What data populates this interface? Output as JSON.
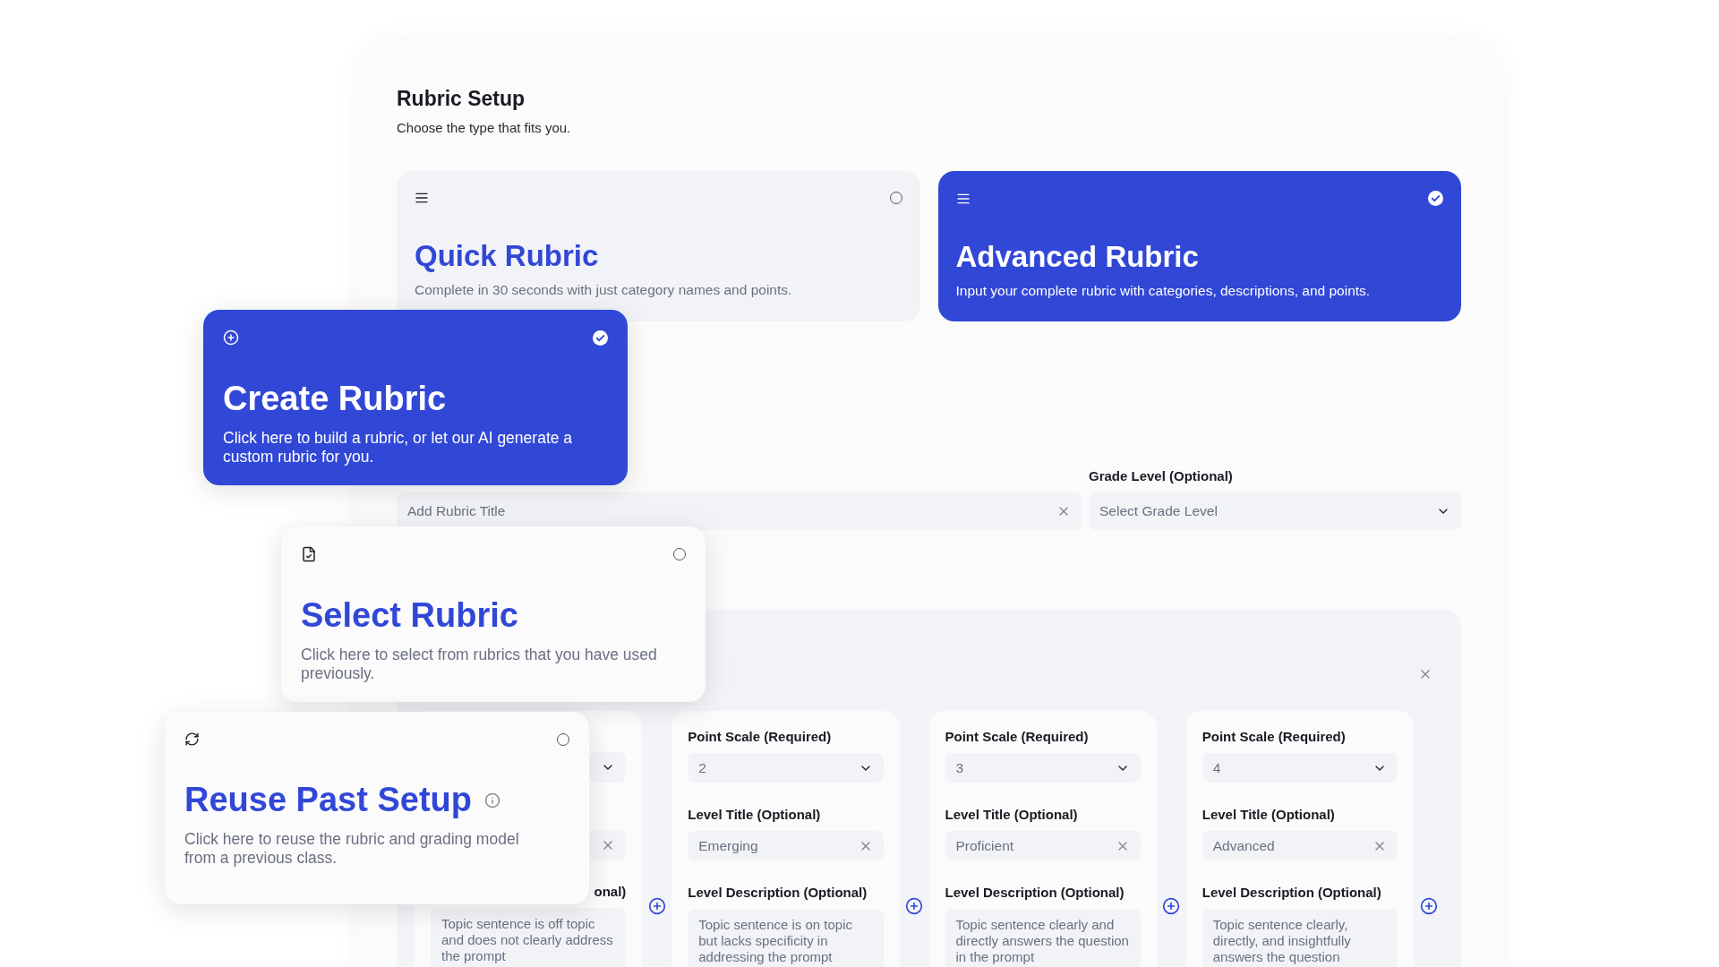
{
  "setup": {
    "title": "Rubric Setup",
    "subtitle": "Choose the type that fits you."
  },
  "rubric_types": [
    {
      "title": "Quick Rubric",
      "description": "Complete in 30 seconds with just category names and points.",
      "selected": false
    },
    {
      "title": "Advanced Rubric",
      "description": "Input your complete rubric with categories, descriptions, and points.",
      "selected": true
    }
  ],
  "title_field": {
    "placeholder": "Add Rubric Title"
  },
  "grade_level": {
    "label": "Grade Level (Optional)",
    "placeholder": "Select Grade Level"
  },
  "levels": [
    {
      "description_label": "onal)",
      "description": "Topic sentence is off topic and does not clearly address the prompt"
    },
    {
      "point_scale_label": "Point Scale (Required)",
      "point_scale": "2",
      "title_label": "Level Title (Optional)",
      "title": "Emerging",
      "description_label": "Level Description (Optional)",
      "description": "Topic sentence is on topic but lacks specificity in addressing the prompt"
    },
    {
      "point_scale_label": "Point Scale (Required)",
      "point_scale": "3",
      "title_label": "Level Title (Optional)",
      "title": "Proficient",
      "description_label": "Level Description (Optional)",
      "description": "Topic sentence clearly and directly answers the question in the prompt"
    },
    {
      "point_scale_label": "Point Scale (Required)",
      "point_scale": "4",
      "title_label": "Level Title (Optional)",
      "title": "Advanced",
      "description_label": "Level Description (Optional)",
      "description": "Topic sentence clearly, directly, and insightfully answers the question"
    }
  ],
  "option_cards": [
    {
      "kind": "create",
      "title": "Create Rubric",
      "description": "Click here to build a rubric, or let our AI generate a custom rubric for you.",
      "selected": true
    },
    {
      "kind": "select",
      "title": "Select Rubric",
      "description": "Click here to select from rubrics that you have used previously.",
      "selected": false
    },
    {
      "kind": "reuse",
      "title": "Reuse Past Setup",
      "description": "Click here to reuse the rubric and grading model from a previous class.",
      "selected": false,
      "info": true
    }
  ]
}
